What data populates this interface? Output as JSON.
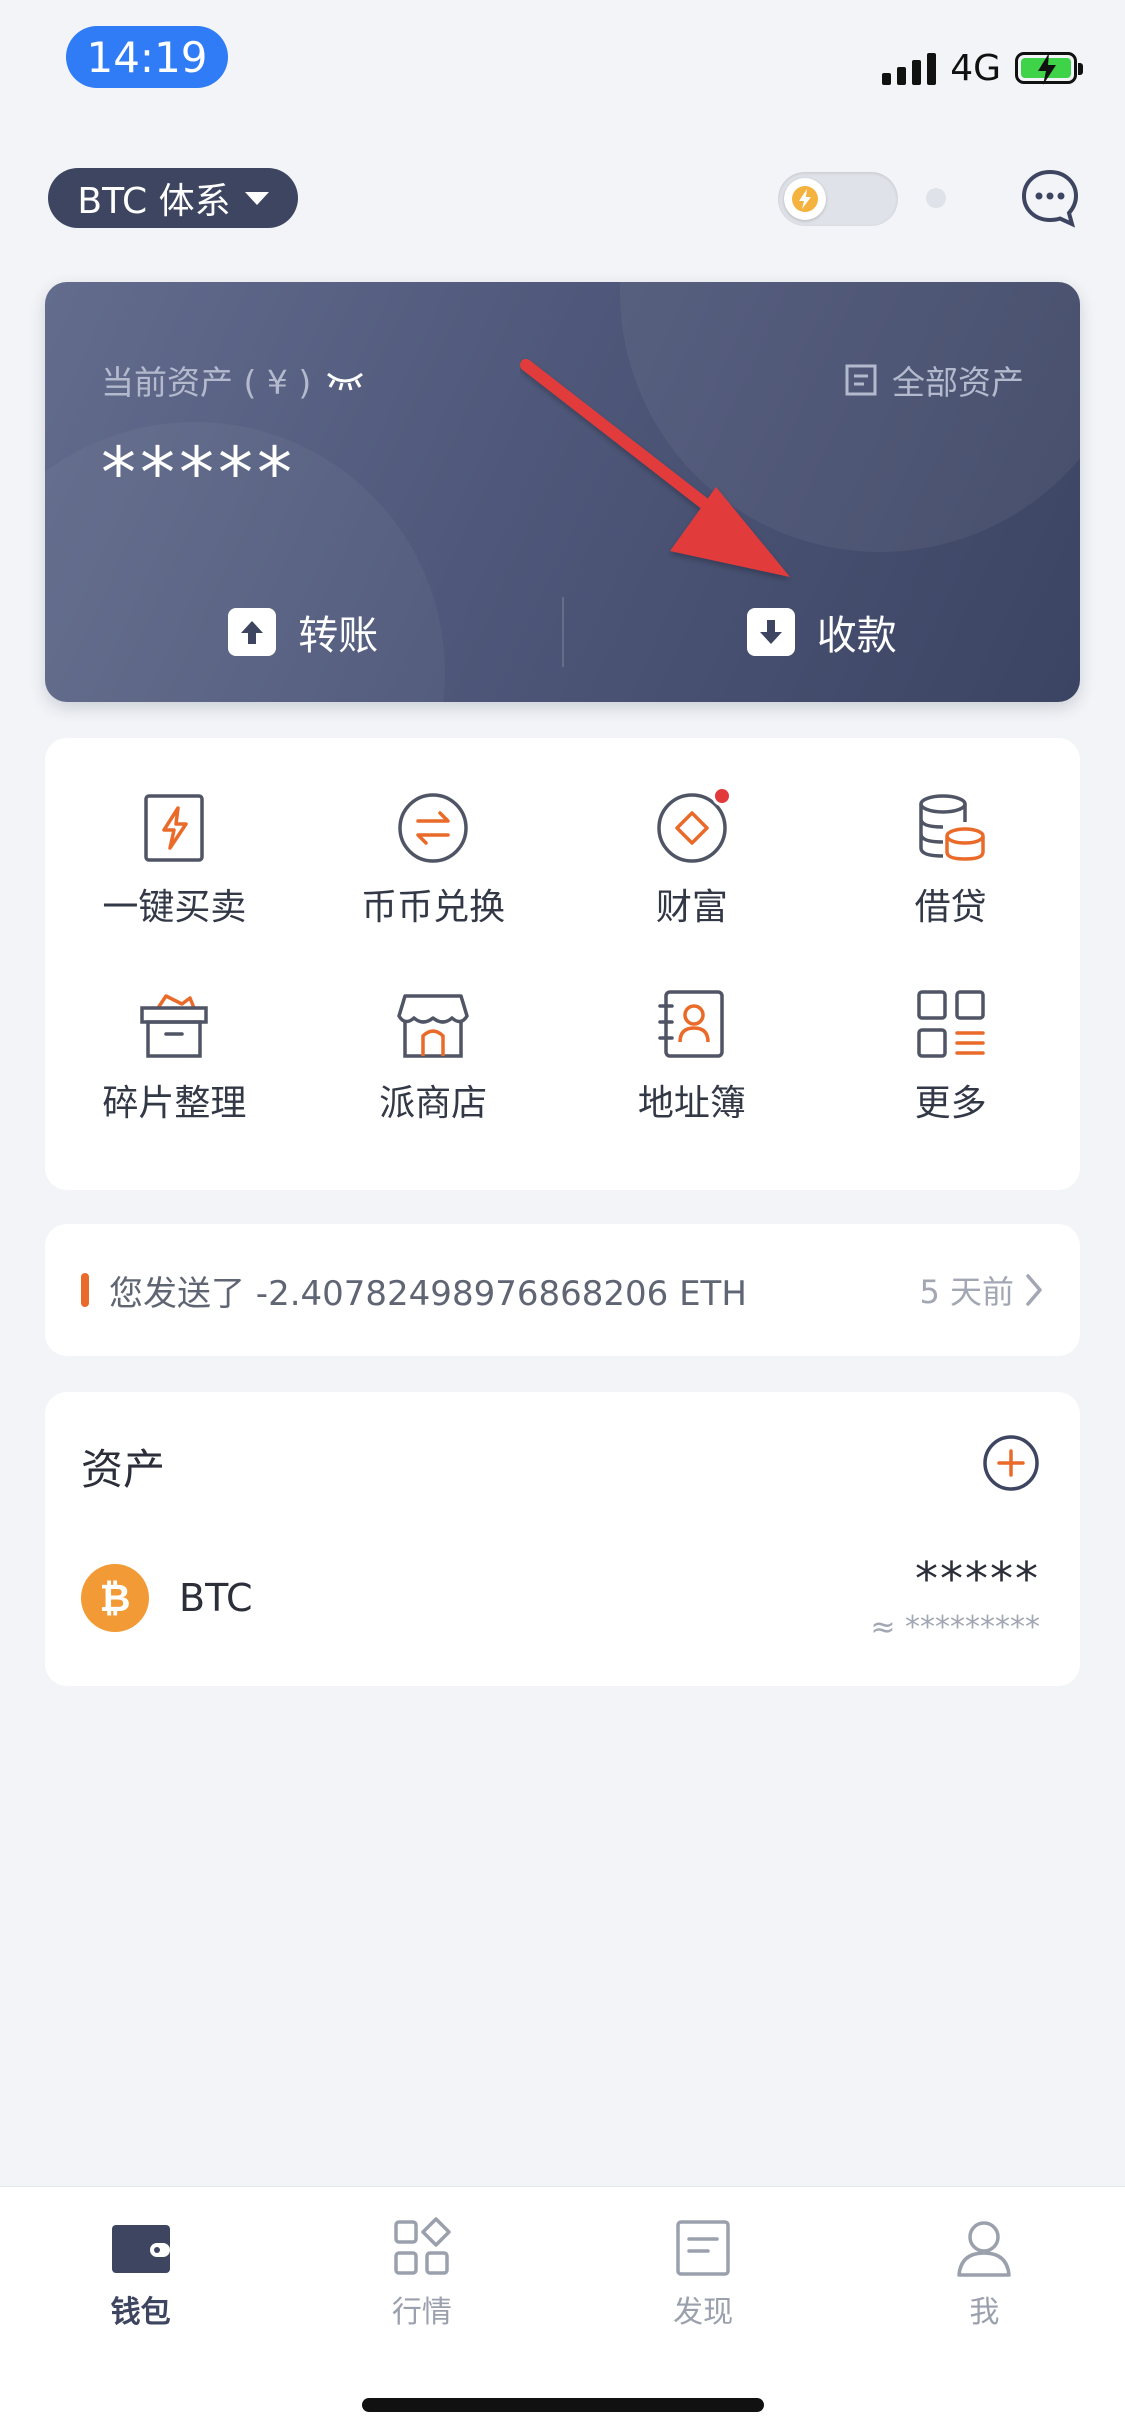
{
  "status_bar": {
    "time": "14:19",
    "network": "4G"
  },
  "header": {
    "system_label": "BTC 体系"
  },
  "asset_card": {
    "label": "当前资产 ( ¥ )",
    "all_assets": "全部资产",
    "value": "*****",
    "transfer_label": "转账",
    "receive_label": "收款"
  },
  "features": {
    "items": [
      {
        "label": "一键买卖",
        "icon": "lightning-card-icon"
      },
      {
        "label": "币币兑换",
        "icon": "exchange-icon"
      },
      {
        "label": "财富",
        "icon": "wealth-diamond-icon"
      },
      {
        "label": "借贷",
        "icon": "coin-stack-icon"
      },
      {
        "label": "碎片整理",
        "icon": "box-icon"
      },
      {
        "label": "派商店",
        "icon": "store-icon"
      },
      {
        "label": "地址簿",
        "icon": "address-book-icon"
      },
      {
        "label": "更多",
        "icon": "more-grid-icon"
      }
    ]
  },
  "notice": {
    "text": "您发送了 -2.40782498976868206 ETH",
    "time": "5 天前"
  },
  "assets": {
    "title": "资产",
    "items": [
      {
        "symbol": "BTC",
        "amount": "*****",
        "fiat": "≈ *********"
      }
    ]
  },
  "tabbar": {
    "tabs": [
      {
        "label": "钱包",
        "active": true
      },
      {
        "label": "行情",
        "active": false
      },
      {
        "label": "发现",
        "active": false
      },
      {
        "label": "我",
        "active": false
      }
    ]
  },
  "colors": {
    "accent_orange": "#ea6a2a",
    "card_dark": "#3d4560",
    "btc_orange": "#f29a35",
    "status_blue": "#2f7cf6",
    "annotation_red": "#e23a3a"
  }
}
